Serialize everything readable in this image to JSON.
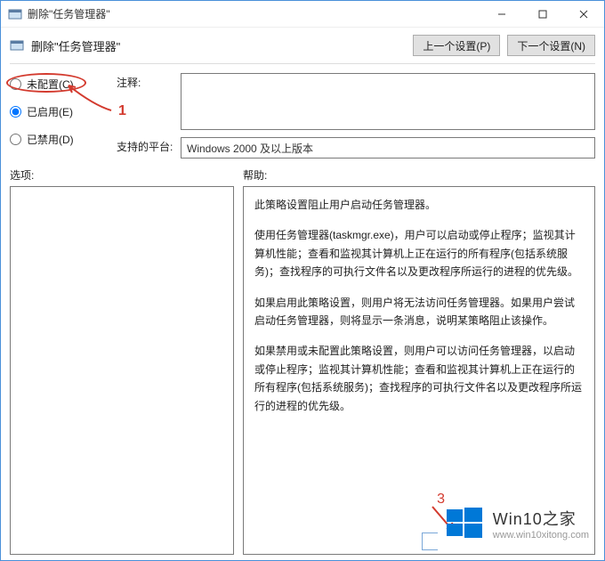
{
  "titlebar": {
    "title": "删除\"任务管理器\""
  },
  "header": {
    "title": "删除\"任务管理器\"",
    "prev": "上一个设置(P)",
    "next": "下一个设置(N)"
  },
  "radios": {
    "not_configured": "未配置(C)",
    "enabled": "已启用(E)",
    "disabled": "已禁用(D)"
  },
  "fields": {
    "comment_label": "注释:",
    "platform_label": "支持的平台:",
    "platform_value": "Windows 2000 及以上版本"
  },
  "lower": {
    "options_label": "选项:",
    "help_label": "帮助:"
  },
  "help": {
    "p1": "此策略设置阻止用户启动任务管理器。",
    "p2": "使用任务管理器(taskmgr.exe)，用户可以启动或停止程序；监视其计算机性能；查看和监视其计算机上正在运行的所有程序(包括系统服务)；查找程序的可执行文件名以及更改程序所运行的进程的优先级。",
    "p3": "如果启用此策略设置，则用户将无法访问任务管理器。如果用户尝试启动任务管理器，则将显示一条消息，说明某策略阻止该操作。",
    "p4": "如果禁用或未配置此策略设置，则用户可以访问任务管理器，以启动或停止程序；监视其计算机性能；查看和监视其计算机上正在运行的所有程序(包括系统服务)；查找程序的可执行文件名以及更改程序所运行的进程的优先级。"
  },
  "annotations": {
    "num1": "1",
    "num3": "3"
  },
  "watermark": {
    "brand": "Win10之家",
    "url": "www.win10xitong.com"
  }
}
